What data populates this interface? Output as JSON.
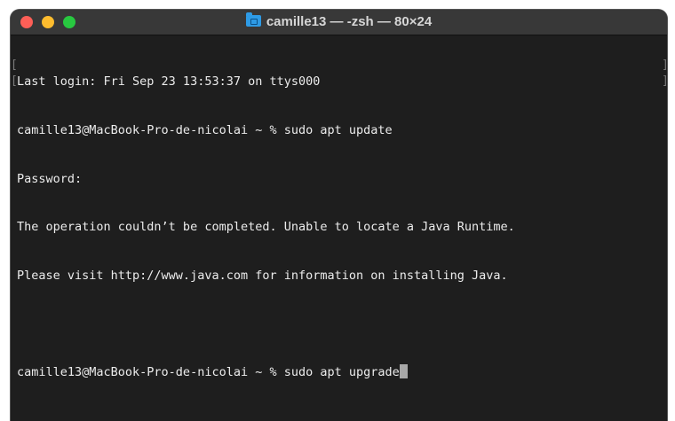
{
  "window": {
    "title": "camille13 — -zsh — 80×24",
    "icon": "folder-icon"
  },
  "terminal": {
    "lines": [
      "Last login: Fri Sep 23 13:53:37 on ttys000",
      "camille13@MacBook-Pro-de-nicolai ~ % sudo apt update",
      "Password:",
      "The operation couldn’t be completed. Unable to locate a Java Runtime.",
      "Please visit http://www.java.com for information on installing Java.",
      "",
      "camille13@MacBook-Pro-de-nicolai ~ % sudo apt upgrade"
    ]
  }
}
